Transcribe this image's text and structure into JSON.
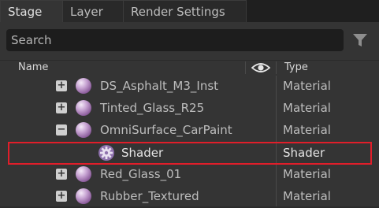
{
  "tabs": [
    {
      "label": "Stage"
    },
    {
      "label": "Layer"
    },
    {
      "label": "Render Settings"
    }
  ],
  "search": {
    "placeholder": "Search"
  },
  "columns": {
    "name": "Name",
    "visibility_icon": "eye-icon",
    "type": "Type"
  },
  "rows": [
    {
      "name": "DS_Asphalt_M3_Inst",
      "type": "Material",
      "expander": "+",
      "icon": "material-sphere-icon"
    },
    {
      "name": "Tinted_Glass_R25",
      "type": "Material",
      "expander": "+",
      "icon": "material-sphere-icon"
    },
    {
      "name": "OmniSurface_CarPaint",
      "type": "Material",
      "expander": "−",
      "icon": "material-sphere-icon"
    },
    {
      "name": "Shader",
      "type": "Shader",
      "icon": "shader-gear-icon",
      "highlighted": true
    },
    {
      "name": "Red_Glass_01",
      "type": "Material",
      "expander": "+",
      "icon": "material-sphere-icon"
    },
    {
      "name": "Rubber_Textured",
      "type": "Material",
      "expander": "+",
      "icon": "material-sphere-icon"
    }
  ],
  "colors": {
    "highlight_border": "#e01e2a",
    "material_sphere": "#b48cc4",
    "shader_icon": "#9b7ab8"
  }
}
